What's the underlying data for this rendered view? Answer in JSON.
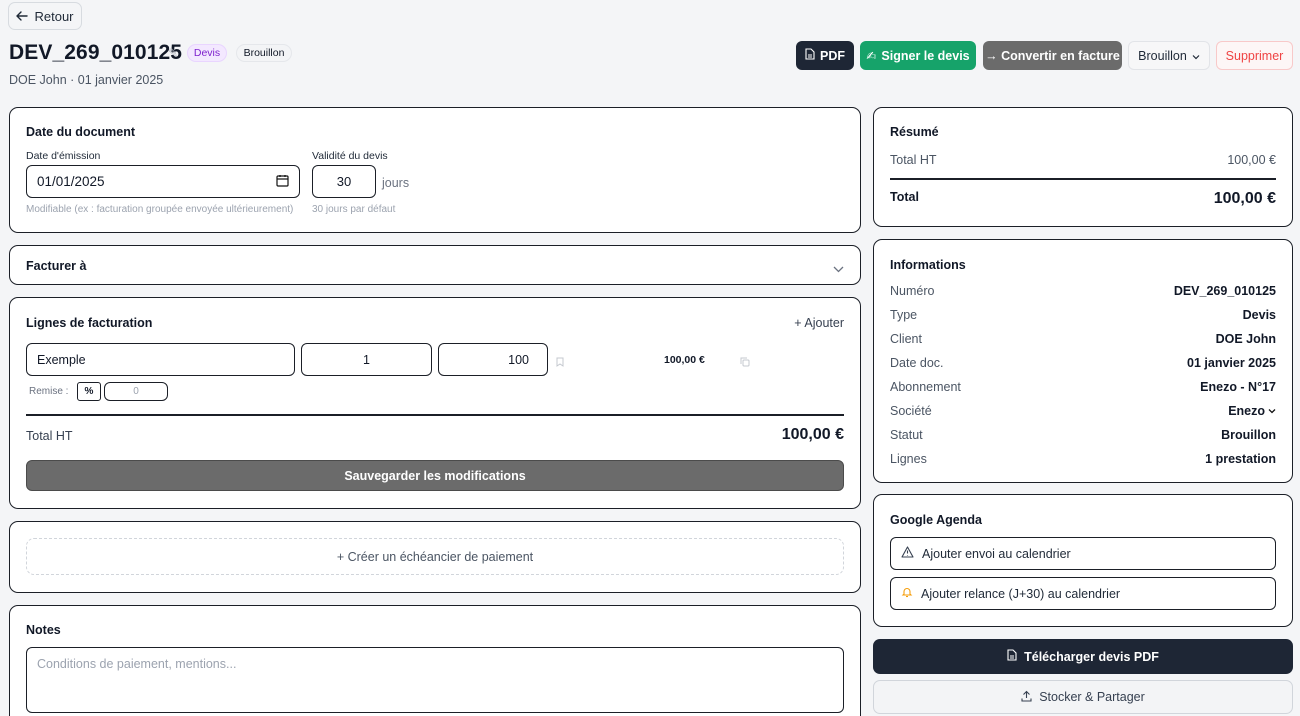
{
  "header": {
    "back_label": "Retour",
    "title": "DEV_269_010125",
    "badge_type": "Devis",
    "badge_status": "Brouillon",
    "subtitle": "DOE John · 01 janvier 2025"
  },
  "toolbar": {
    "pdf_label": "PDF",
    "sign_label": "Signer le devis",
    "convert_label": "→ Convertir en facture",
    "status_label": "Brouillon",
    "delete_label": "Supprimer"
  },
  "document_date": {
    "title": "Date du document",
    "emission_label": "Date d'émission",
    "emission_value": "01/01/2025",
    "emission_hint": "Modifiable (ex : facturation groupée envoyée ultérieurement)",
    "validity_label": "Validité du devis",
    "validity_value": "30",
    "validity_unit": "jours",
    "validity_hint": "30 jours par défaut"
  },
  "bill_to": {
    "title": "Facturer à"
  },
  "lines": {
    "title": "Lignes de facturation",
    "add_label": "+ Ajouter",
    "items": [
      {
        "description": "Exemple",
        "quantity": "1",
        "price": "100",
        "total": "100,00 €"
      }
    ],
    "discount_label": "Remise :",
    "discount_type": "%",
    "discount_value": "0",
    "total_label": "Total HT",
    "total_value": "100,00 €",
    "save_label": "Sauvegarder les modifications"
  },
  "schedule": {
    "create_label": "+ Créer un échéancier de paiement"
  },
  "notes": {
    "title": "Notes",
    "placeholder": "Conditions de paiement, mentions..."
  },
  "summary": {
    "title": "Résumé",
    "total_ht_label": "Total HT",
    "total_ht_value": "100,00 €",
    "total_label": "Total",
    "total_value": "100,00 €"
  },
  "info": {
    "title": "Informations",
    "rows": [
      {
        "key": "Numéro",
        "value": "DEV_269_010125"
      },
      {
        "key": "Type",
        "value": "Devis"
      },
      {
        "key": "Client",
        "value": "DOE John"
      },
      {
        "key": "Date doc.",
        "value": "01 janvier 2025"
      },
      {
        "key": "Abonnement",
        "value": "Enezo - N°17"
      },
      {
        "key": "Société",
        "value": "Enezo"
      },
      {
        "key": "Statut",
        "value": "Brouillon"
      },
      {
        "key": "Lignes",
        "value": "1 prestation"
      }
    ]
  },
  "agenda": {
    "title": "Google Agenda",
    "send_label": "Ajouter envoi au calendrier",
    "reminder_label": "Ajouter relance (J+30) au calendrier"
  },
  "actions": {
    "download_label": "Télécharger devis PDF",
    "share_label": "Stocker & Partager"
  },
  "colors": {
    "primary_dark": "#1e2635",
    "sign_green": "#16a36a",
    "convert_gray": "#6b6b6b",
    "delete_red": "#ef4444",
    "badge_purple": "#7e22ce"
  }
}
